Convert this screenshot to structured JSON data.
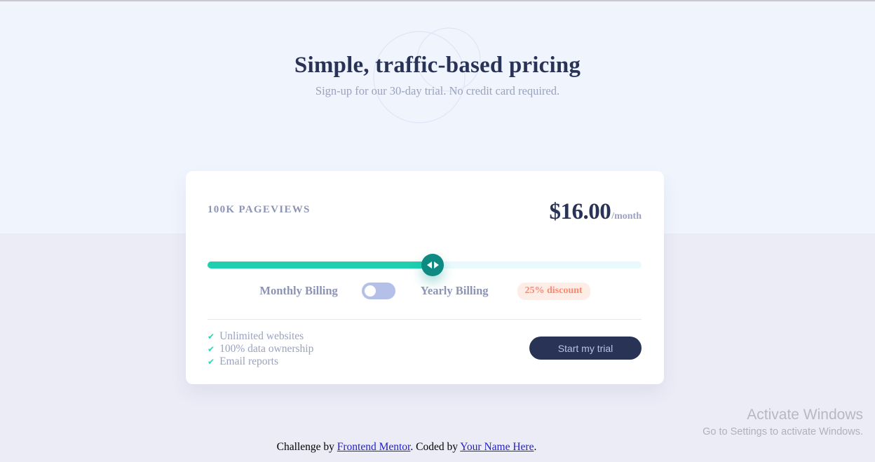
{
  "header": {
    "title": "Simple, traffic-based pricing",
    "subtitle": "Sign-up for our 30-day trial. No credit card required."
  },
  "card": {
    "pageviews_label": "100K PAGEVIEWS",
    "price_amount": "$16.00",
    "price_period": "/month",
    "slider": {
      "value_percent": 50,
      "left_arrow_icon": "arrow-left-icon",
      "right_arrow_icon": "arrow-right-icon",
      "fill_color": "#1ecfb0",
      "track_color": "#eaf9fc",
      "thumb_color": "#0e8a83"
    },
    "billing": {
      "monthly_label": "Monthly Billing",
      "yearly_label": "Yearly Billing",
      "toggle_state": "monthly",
      "discount_badge": "25% discount",
      "badge_bg": "#feece7",
      "badge_color": "#fd8a6f"
    },
    "features": [
      "Unlimited websites",
      "100% data ownership",
      "Email reports"
    ],
    "check_icon": "check-icon",
    "cta_label": "Start my trial",
    "cta_bg": "#293356"
  },
  "watermark": {
    "title": "Activate Windows",
    "subtitle": "Go to Settings to activate Windows."
  },
  "footer": {
    "prefix": "Challenge by ",
    "link1": "Frontend Mentor",
    "middle": ". Coded by ",
    "link2": "Your Name Here",
    "suffix": "."
  }
}
